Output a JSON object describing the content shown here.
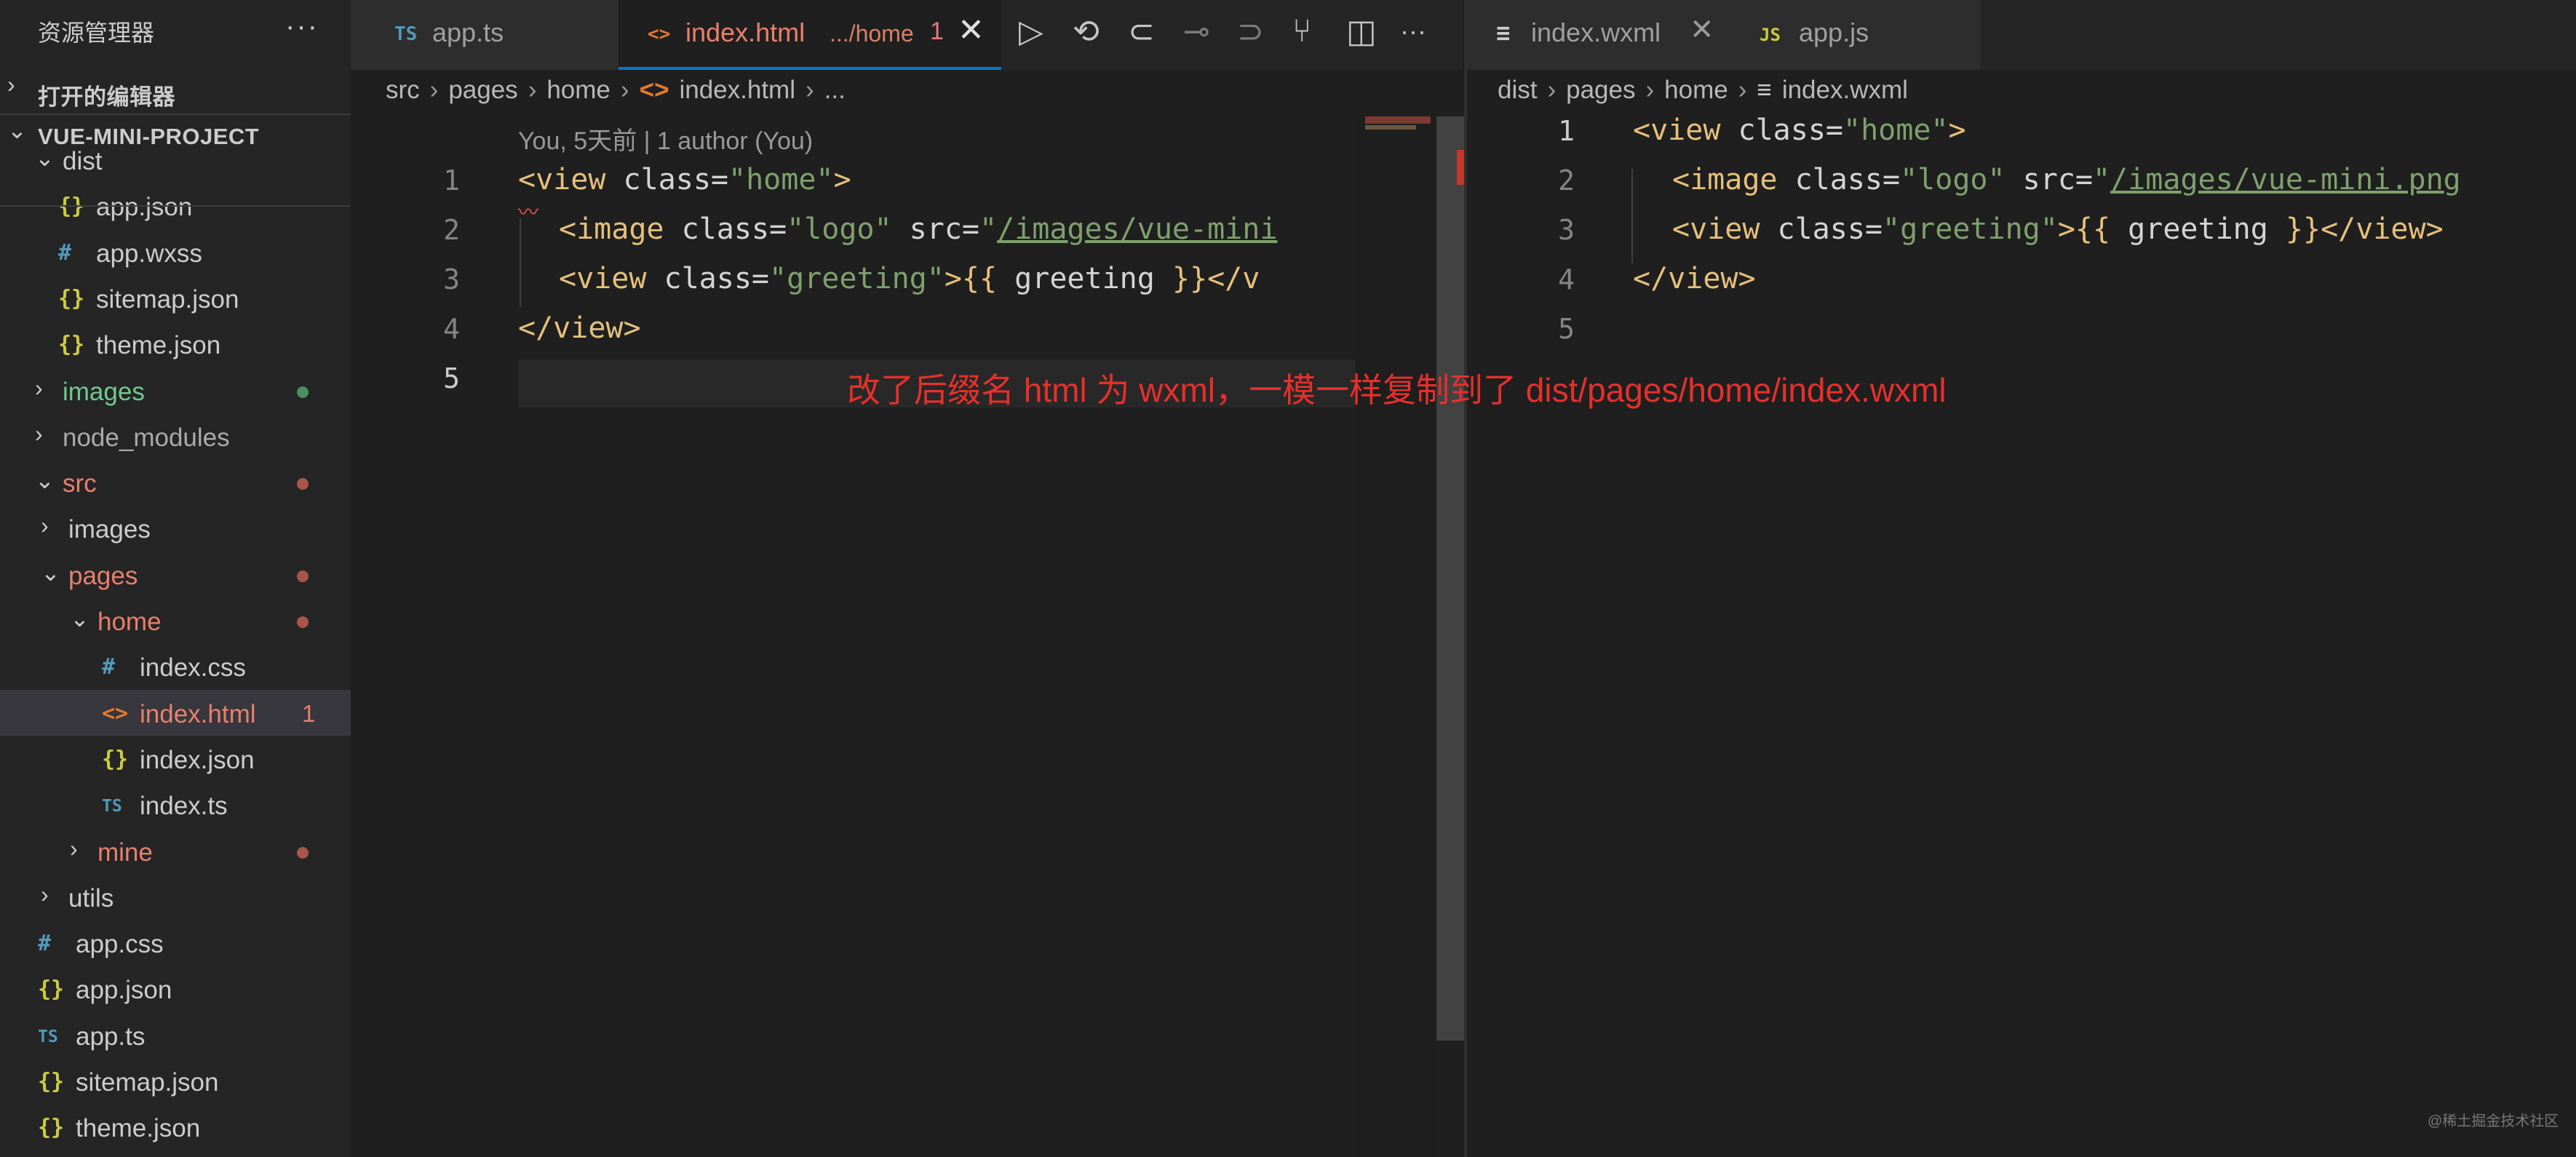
{
  "sidebar": {
    "title": "资源管理器",
    "more": "···",
    "sections": {
      "open_editors": {
        "chevron": "›",
        "label": "打开的编辑器"
      },
      "project": {
        "chevron": "⌄",
        "label": "VUE-MINI-PROJECT"
      }
    },
    "tree": [
      {
        "chev": "⌄",
        "icon": "",
        "name": "dist",
        "kind": "folder",
        "color": "#cccccc"
      },
      {
        "chev": "",
        "icon": "{}",
        "name": "app.json",
        "kind": "json",
        "color": "#cccccc"
      },
      {
        "chev": "",
        "icon": "#",
        "name": "app.wxss",
        "kind": "css",
        "color": "#cccccc"
      },
      {
        "chev": "",
        "icon": "{}",
        "name": "sitemap.json",
        "kind": "json",
        "color": "#cccccc"
      },
      {
        "chev": "",
        "icon": "{}",
        "name": "theme.json",
        "kind": "json",
        "color": "#cccccc"
      },
      {
        "chev": "›",
        "icon": "",
        "name": "images",
        "kind": "folder",
        "color": "#73c991",
        "dot": "#4e8e5e"
      },
      {
        "chev": "›",
        "icon": "",
        "name": "node_modules",
        "kind": "folder",
        "color": "#aaaaaa"
      },
      {
        "chev": "⌄",
        "icon": "",
        "name": "src",
        "kind": "folder",
        "color": "#e8806c",
        "dot": "#a8564a"
      },
      {
        "chev": "›",
        "icon": "",
        "name": "images",
        "kind": "folder",
        "color": "#cccccc"
      },
      {
        "chev": "⌄",
        "icon": "",
        "name": "pages",
        "kind": "folder",
        "color": "#e8806c",
        "dot": "#a8564a"
      },
      {
        "chev": "⌄",
        "icon": "",
        "name": "home",
        "kind": "folder",
        "color": "#e8806c",
        "dot": "#a8564a"
      },
      {
        "chev": "",
        "icon": "#",
        "name": "index.css",
        "kind": "css",
        "color": "#cccccc"
      },
      {
        "chev": "",
        "icon": "<>",
        "name": "index.html",
        "kind": "html",
        "color": "#e8806c",
        "badge": "1",
        "selected": true
      },
      {
        "chev": "",
        "icon": "{}",
        "name": "index.json",
        "kind": "json",
        "color": "#cccccc"
      },
      {
        "chev": "",
        "icon": "TS",
        "name": "index.ts",
        "kind": "ts",
        "color": "#cccccc"
      },
      {
        "chev": "›",
        "icon": "",
        "name": "mine",
        "kind": "folder",
        "color": "#e8806c",
        "dot": "#a8564a"
      },
      {
        "chev": "›",
        "icon": "",
        "name": "utils",
        "kind": "folder",
        "color": "#cccccc"
      },
      {
        "chev": "",
        "icon": "#",
        "name": "app.css",
        "kind": "css",
        "color": "#cccccc"
      },
      {
        "chev": "",
        "icon": "{}",
        "name": "app.json",
        "kind": "json",
        "color": "#cccccc"
      },
      {
        "chev": "",
        "icon": "TS",
        "name": "app.ts",
        "kind": "ts",
        "color": "#cccccc"
      },
      {
        "chev": "",
        "icon": "{}",
        "name": "sitemap.json",
        "kind": "json",
        "color": "#cccccc"
      },
      {
        "chev": "",
        "icon": "{}",
        "name": "theme.json",
        "kind": "json",
        "color": "#cccccc"
      }
    ]
  },
  "left_editor": {
    "tabs": {
      "appts": {
        "icon": "TS",
        "label": "app.ts"
      },
      "indexhtml": {
        "icon": "<>",
        "label": "index.html",
        "path": ".../home",
        "badge": "1",
        "close": "✕"
      }
    },
    "breadcrumb": {
      "p1": "src",
      "p2": "pages",
      "p3": "home",
      "file_icon": "<>",
      "file": "index.html",
      "tail": "...",
      "sep": "›"
    },
    "codelens": "You, 5天前 | 1 author (You)",
    "line_numbers": [
      "1",
      "2",
      "3",
      "4",
      "5"
    ],
    "code": {
      "l1": {
        "open": "<",
        "tag": "view",
        "attr": " class=",
        "val": "\"home\"",
        "close": ">"
      },
      "l2": {
        "open": "<",
        "tag": "image",
        "attr1": " class=",
        "val1": "\"logo\"",
        "attr2": " src=",
        "q": "\"",
        "url": "/images/vue-mini"
      },
      "l3": {
        "open": "<",
        "tag": "view",
        "attr": " class=",
        "val": "\"greeting\"",
        "close": ">",
        "mus": "{{ ",
        "var": "greeting",
        "mus2": " }}",
        "end": "</v"
      },
      "l4": {
        "text": "</view>"
      }
    }
  },
  "toolbar_icons": [
    "run-icon",
    "history-icon",
    "go-back-icon",
    "git-commit-icon",
    "go-forward-icon",
    "git-compare-icon",
    "split-editor-icon",
    "more-icon"
  ],
  "toolbar_glyphs": {
    "run": "▷",
    "history": "⟲",
    "back": "⊂",
    "commit": "⊸",
    "forward": "⊃",
    "compare": "⑂",
    "split": "◫",
    "more": "···"
  },
  "annotation": "改了后缀名 html 为 wxml，一模一样复制到了 dist/pages/home/index.wxml",
  "right_editor": {
    "tabs": {
      "wxml": {
        "icon": "≡",
        "label": "index.wxml",
        "close": "✕"
      },
      "appjs": {
        "icon": "JS",
        "label": "app.js"
      }
    },
    "breadcrumb": {
      "p1": "dist",
      "p2": "pages",
      "p3": "home",
      "file_icon": "≡",
      "file": "index.wxml",
      "sep": "›"
    },
    "line_numbers": [
      "1",
      "2",
      "3",
      "4",
      "5"
    ],
    "code": {
      "l1": {
        "open": "<",
        "tag": "view",
        "attr": " class=",
        "val": "\"home\"",
        "close": ">"
      },
      "l2": {
        "open": "<",
        "tag": "image",
        "attr1": " class=",
        "val1": "\"logo\"",
        "attr2": " src=",
        "q": "\"",
        "url": "/images/vue-mini.png"
      },
      "l3": {
        "open": "<",
        "tag": "view",
        "attr": " class=",
        "val": "\"greeting\"",
        "close": ">",
        "mus": "{{ ",
        "var": "greeting",
        "mus2": " }}",
        "end": "</view>"
      },
      "l4": {
        "text": "</view>"
      }
    }
  },
  "watermark": "@稀土掘金技术社区"
}
